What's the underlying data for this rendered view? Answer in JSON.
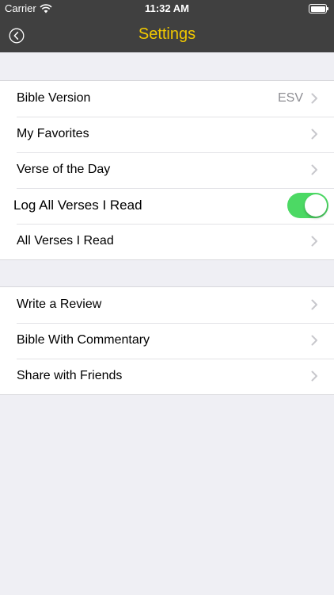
{
  "status_bar": {
    "carrier": "Carrier",
    "time": "11:32 AM",
    "wifi_icon": "wifi-icon",
    "battery_icon": "battery-icon"
  },
  "nav": {
    "title": "Settings",
    "back_icon": "back-circle-icon",
    "title_color": "#f0c800",
    "bar_color": "#404040"
  },
  "groups": [
    {
      "rows": [
        {
          "label": "Bible Version",
          "value": "ESV",
          "accessory": "chevron"
        },
        {
          "label": "My Favorites",
          "accessory": "chevron"
        },
        {
          "label": "Verse of the Day",
          "accessory": "chevron"
        },
        {
          "label": "Log All Verses I Read",
          "accessory": "toggle",
          "toggle_on": true
        },
        {
          "label": "All Verses I Read",
          "accessory": "chevron"
        }
      ]
    },
    {
      "rows": [
        {
          "label": "Write a Review",
          "accessory": "chevron"
        },
        {
          "label": "Bible With Commentary",
          "accessory": "chevron"
        },
        {
          "label": "Share with Friends",
          "accessory": "chevron"
        }
      ]
    }
  ],
  "colors": {
    "toggle_on": "#4cd964",
    "background": "#efeff4",
    "secondary_text": "#8e8e93"
  }
}
